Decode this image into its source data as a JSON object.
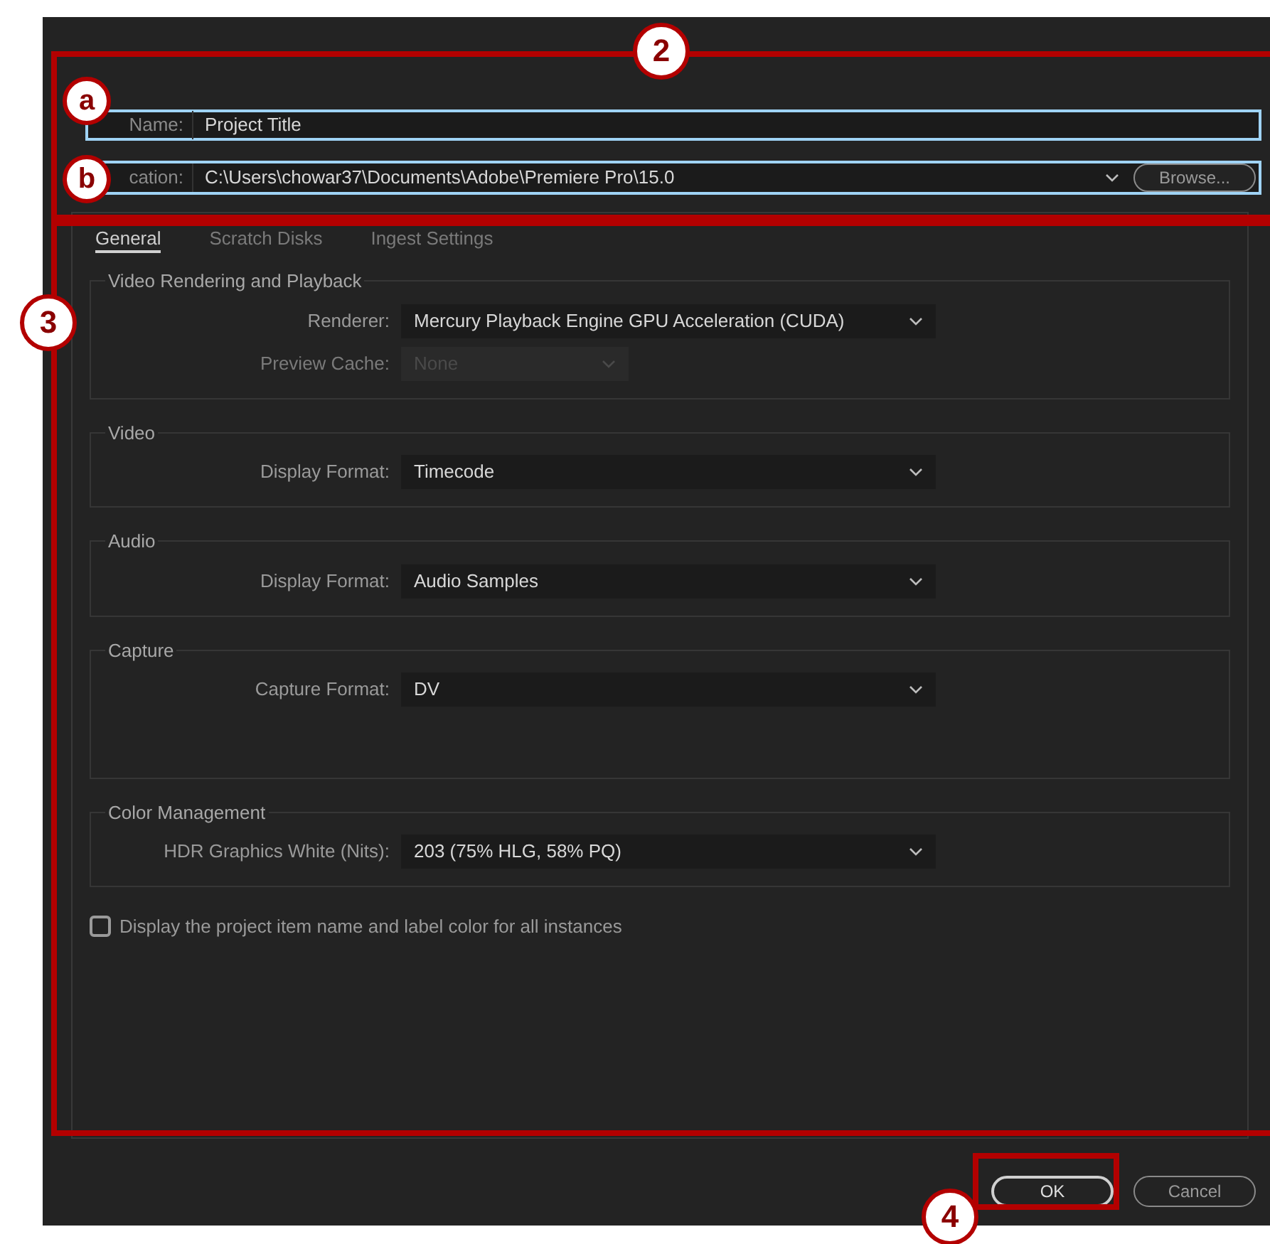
{
  "name_field": {
    "label": "Name:",
    "value": "Project Title"
  },
  "location_field": {
    "label": "cation:",
    "value": "C:\\Users\\chowar37\\Documents\\Adobe\\Premiere Pro\\15.0",
    "browse": "Browse..."
  },
  "tabs": [
    {
      "label": "General",
      "selected": true
    },
    {
      "label": "Scratch Disks",
      "selected": false
    },
    {
      "label": "Ingest Settings",
      "selected": false
    }
  ],
  "groups": [
    {
      "title": "Video Rendering and Playback",
      "rows": [
        {
          "label": "Renderer:",
          "value": "Mercury Playback Engine GPU Acceleration (CUDA)",
          "disabled": false
        },
        {
          "label": "Preview Cache:",
          "value": "None",
          "disabled": true
        }
      ]
    },
    {
      "title": "Video",
      "rows": [
        {
          "label": "Display Format:",
          "value": "Timecode",
          "disabled": false
        }
      ]
    },
    {
      "title": "Audio",
      "rows": [
        {
          "label": "Display Format:",
          "value": "Audio Samples",
          "disabled": false
        }
      ]
    },
    {
      "title": "Capture",
      "rows": [
        {
          "label": "Capture Format:",
          "value": "DV",
          "disabled": false
        }
      ],
      "tall": true
    },
    {
      "title": "Color Management",
      "rows": [
        {
          "label": "HDR Graphics White (Nits):",
          "value": "203 (75% HLG, 58% PQ)",
          "disabled": false
        }
      ]
    }
  ],
  "checkbox": {
    "label": "Display the project item name and label color for all instances",
    "checked": false
  },
  "buttons": [
    {
      "label": "OK",
      "kind": "primary"
    },
    {
      "label": "Cancel",
      "kind": "secondary"
    }
  ],
  "annotations": [
    {
      "label": "2"
    },
    {
      "label": "a"
    },
    {
      "label": "b"
    },
    {
      "label": "3"
    },
    {
      "label": "4"
    }
  ]
}
